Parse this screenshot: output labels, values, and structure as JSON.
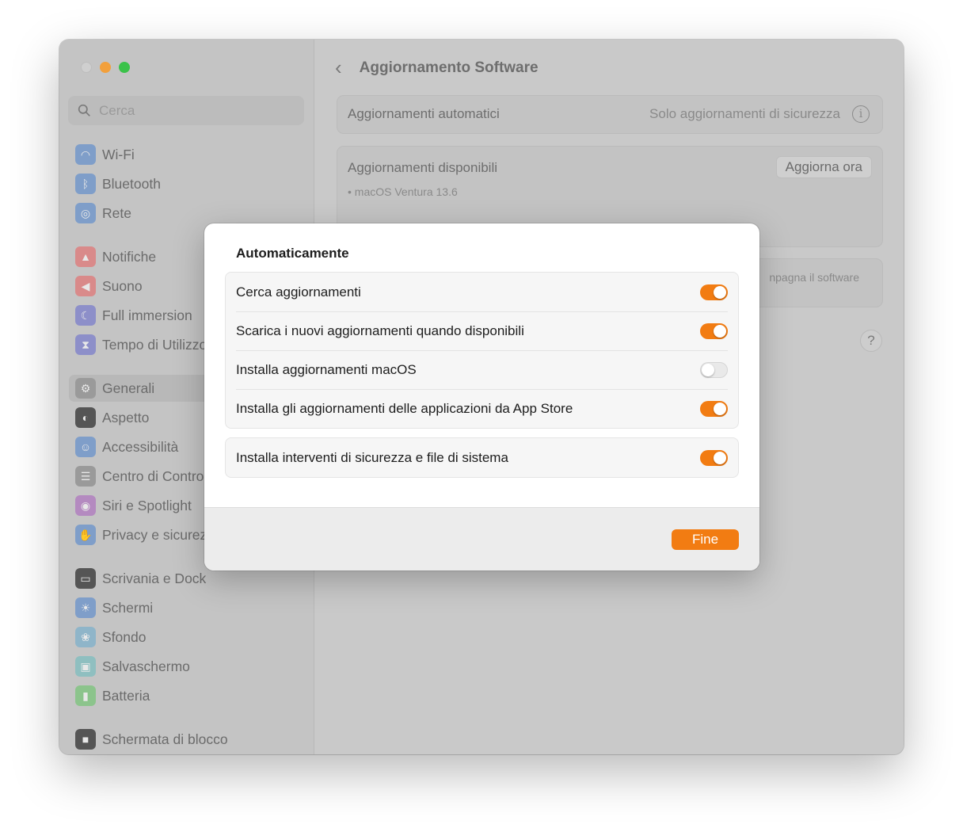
{
  "sidebar": {
    "search_placeholder": "Cerca",
    "items": [
      {
        "label": "Wi-Fi",
        "icon": "wifi-icon",
        "color": "#7f9ec9"
      },
      {
        "label": "Bluetooth",
        "icon": "bluetooth-icon",
        "color": "#7f9ec9"
      },
      {
        "label": "Rete",
        "icon": "globe-icon",
        "color": "#7f9ec9"
      },
      {
        "label": "Notifiche",
        "icon": "bell-icon",
        "color": "#d98a8a"
      },
      {
        "label": "Suono",
        "icon": "speaker-icon",
        "color": "#d98a8a"
      },
      {
        "label": "Full immersion",
        "icon": "moon-icon",
        "color": "#8d8fc9"
      },
      {
        "label": "Tempo di Utilizzo",
        "icon": "hourglass-icon",
        "color": "#8d8fc9"
      },
      {
        "label": "Generali",
        "icon": "gear-icon",
        "color": "#9a9a9a",
        "selected": true
      },
      {
        "label": "Aspetto",
        "icon": "appearance-icon",
        "color": "#555555"
      },
      {
        "label": "Accessibilità",
        "icon": "accessibility-icon",
        "color": "#7f9ec9"
      },
      {
        "label": "Centro di Controllo",
        "icon": "control-center-icon",
        "color": "#9a9a9a"
      },
      {
        "label": "Siri e Spotlight",
        "icon": "siri-icon",
        "color": "#b48ac0"
      },
      {
        "label": "Privacy e sicurezza",
        "icon": "hand-icon",
        "color": "#7f9ec9"
      },
      {
        "label": "Scrivania e Dock",
        "icon": "dock-icon",
        "color": "#555555"
      },
      {
        "label": "Schermi",
        "icon": "display-icon",
        "color": "#7f9ec9"
      },
      {
        "label": "Sfondo",
        "icon": "wallpaper-icon",
        "color": "#8fb5c9"
      },
      {
        "label": "Salvaschermo",
        "icon": "screensaver-icon",
        "color": "#8fbfc0"
      },
      {
        "label": "Batteria",
        "icon": "battery-icon",
        "color": "#8cc48c"
      },
      {
        "label": "Schermata di blocco",
        "icon": "lock-icon",
        "color": "#555555"
      }
    ]
  },
  "main": {
    "title": "Aggiornamento Software",
    "auto_updates_label": "Aggiornamenti automatici",
    "auto_updates_value": "Solo aggiornamenti di sicurezza",
    "available_label": "Aggiornamenti disponibili",
    "available_item": "• macOS Ventura 13.6",
    "update_now": "Aggiorna ora",
    "license_fragment": "npagna il software",
    "help": "?"
  },
  "modal": {
    "title": "Automaticamente",
    "options": [
      {
        "label": "Cerca aggiornamenti",
        "on": true
      },
      {
        "label": "Scarica i nuovi aggiornamenti quando disponibili",
        "on": true
      },
      {
        "label": "Installa aggiornamenti macOS",
        "on": false
      },
      {
        "label": "Installa gli aggiornamenti delle applicazioni da App Store",
        "on": true
      }
    ],
    "security_option": {
      "label": "Installa interventi di sicurezza e file di sistema",
      "on": true
    },
    "done": "Fine"
  },
  "accent_color": "#f27c12"
}
